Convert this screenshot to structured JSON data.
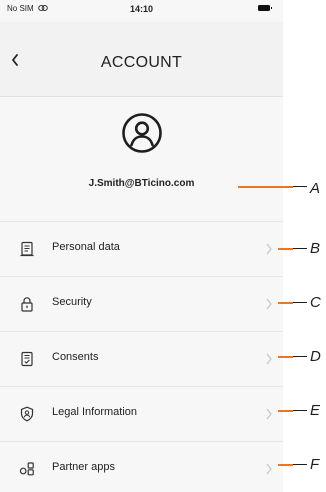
{
  "status_bar": {
    "carrier": "No SIM",
    "time": "14:10"
  },
  "header": {
    "title": "ACCOUNT"
  },
  "profile": {
    "email": "J.Smith@BTicino.com"
  },
  "menu": [
    {
      "label": "Personal data",
      "icon": "personal-data-icon"
    },
    {
      "label": "Security",
      "icon": "lock-icon"
    },
    {
      "label": "Consents",
      "icon": "consents-icon"
    },
    {
      "label": "Legal Information",
      "icon": "shield-user-icon"
    },
    {
      "label": "Partner apps",
      "icon": "partner-apps-icon"
    }
  ],
  "callouts": [
    "A",
    "B",
    "C",
    "D",
    "E",
    "F"
  ],
  "colors": {
    "accent_line": "#e87722",
    "background": "#f7f7f7",
    "text": "#222222"
  }
}
